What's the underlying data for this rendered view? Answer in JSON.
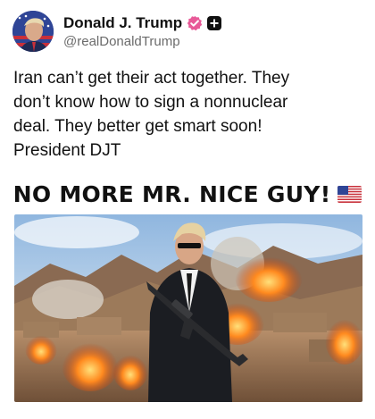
{
  "author": {
    "display_name": "Donald J. Trump",
    "handle": "@realDonaldTrump"
  },
  "post": {
    "text": "Iran can’t get their act together. They\ndon’t know how to sign a nonnuclear\ndeal. They better get smart soon!\nPresident DJT"
  },
  "image_headline": "NO MORE MR. NICE GUY!",
  "icons": {
    "verified": "verified-badge-icon",
    "plus": "plus-badge-icon",
    "flag": "us-flag-icon"
  },
  "colors": {
    "verified_badge": "#e85a98",
    "plus_badge": "#111111",
    "text": "#111111",
    "handle": "#6b6b6b"
  }
}
